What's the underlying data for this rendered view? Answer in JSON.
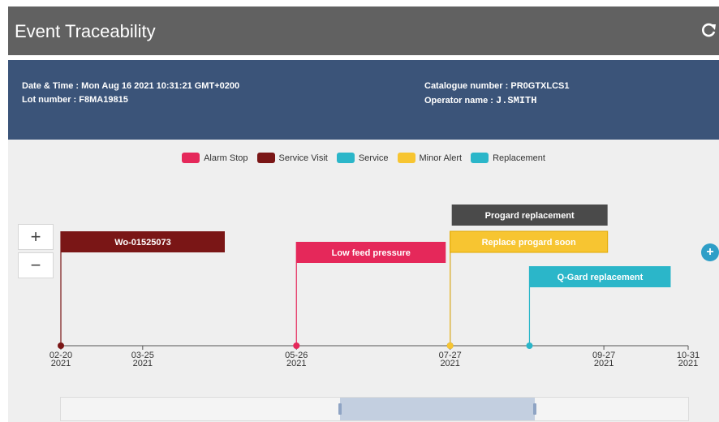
{
  "window": {
    "title": "Event Traceability"
  },
  "info": {
    "datetime_label": "Date & Time :",
    "datetime_value": "Mon Aug 16 2021 10:31:21 GMT+0200",
    "lot_label": "Lot number :",
    "lot_value": "F8MA19815",
    "catalogue_label": "Catalogue number :",
    "catalogue_value": "PR0GTXLCS1",
    "operator_label": "Operator name :",
    "operator_value": "J.SMITH"
  },
  "legend": [
    {
      "label": "Alarm Stop",
      "color": "#e5285a"
    },
    {
      "label": "Service Visit",
      "color": "#7a1616"
    },
    {
      "label": "Service",
      "color": "#2bb6c9"
    },
    {
      "label": "Minor Alert",
      "color": "#f7c531"
    },
    {
      "label": "Replacement",
      "color": "#2bb6c9"
    }
  ],
  "zoom": {
    "in_label": "+",
    "out_label": "−"
  },
  "axis_ticks": [
    {
      "date": "02-20",
      "year": "2021"
    },
    {
      "date": "03-25",
      "year": "2021"
    },
    {
      "date": "05-26",
      "year": "2021"
    },
    {
      "date": "07-27",
      "year": "2021"
    },
    {
      "date": "09-27",
      "year": "2021"
    },
    {
      "date": "10-31",
      "year": "2021"
    }
  ],
  "events": [
    {
      "label": "Wo-01525073",
      "type": "Service Visit",
      "color": "#7a1616",
      "date": "2021-02-20"
    },
    {
      "label": "Low feed pressure",
      "type": "Alarm Stop",
      "color": "#e5285a",
      "date": "2021-05-26"
    },
    {
      "label": "Progard replacement",
      "type": "Replacement",
      "color": "#4a4a4a",
      "date": "2021-07-27"
    },
    {
      "label": "Replace progard soon",
      "type": "Minor Alert",
      "color": "#f7c531",
      "date": "2021-07-27"
    },
    {
      "label": "Q-Gard replacement",
      "type": "Replacement",
      "color": "#2bb6c9",
      "date": "2021-08-28"
    }
  ],
  "colors": {
    "header": "#616161",
    "info_band": "#3b5479",
    "axis": "#555555"
  }
}
